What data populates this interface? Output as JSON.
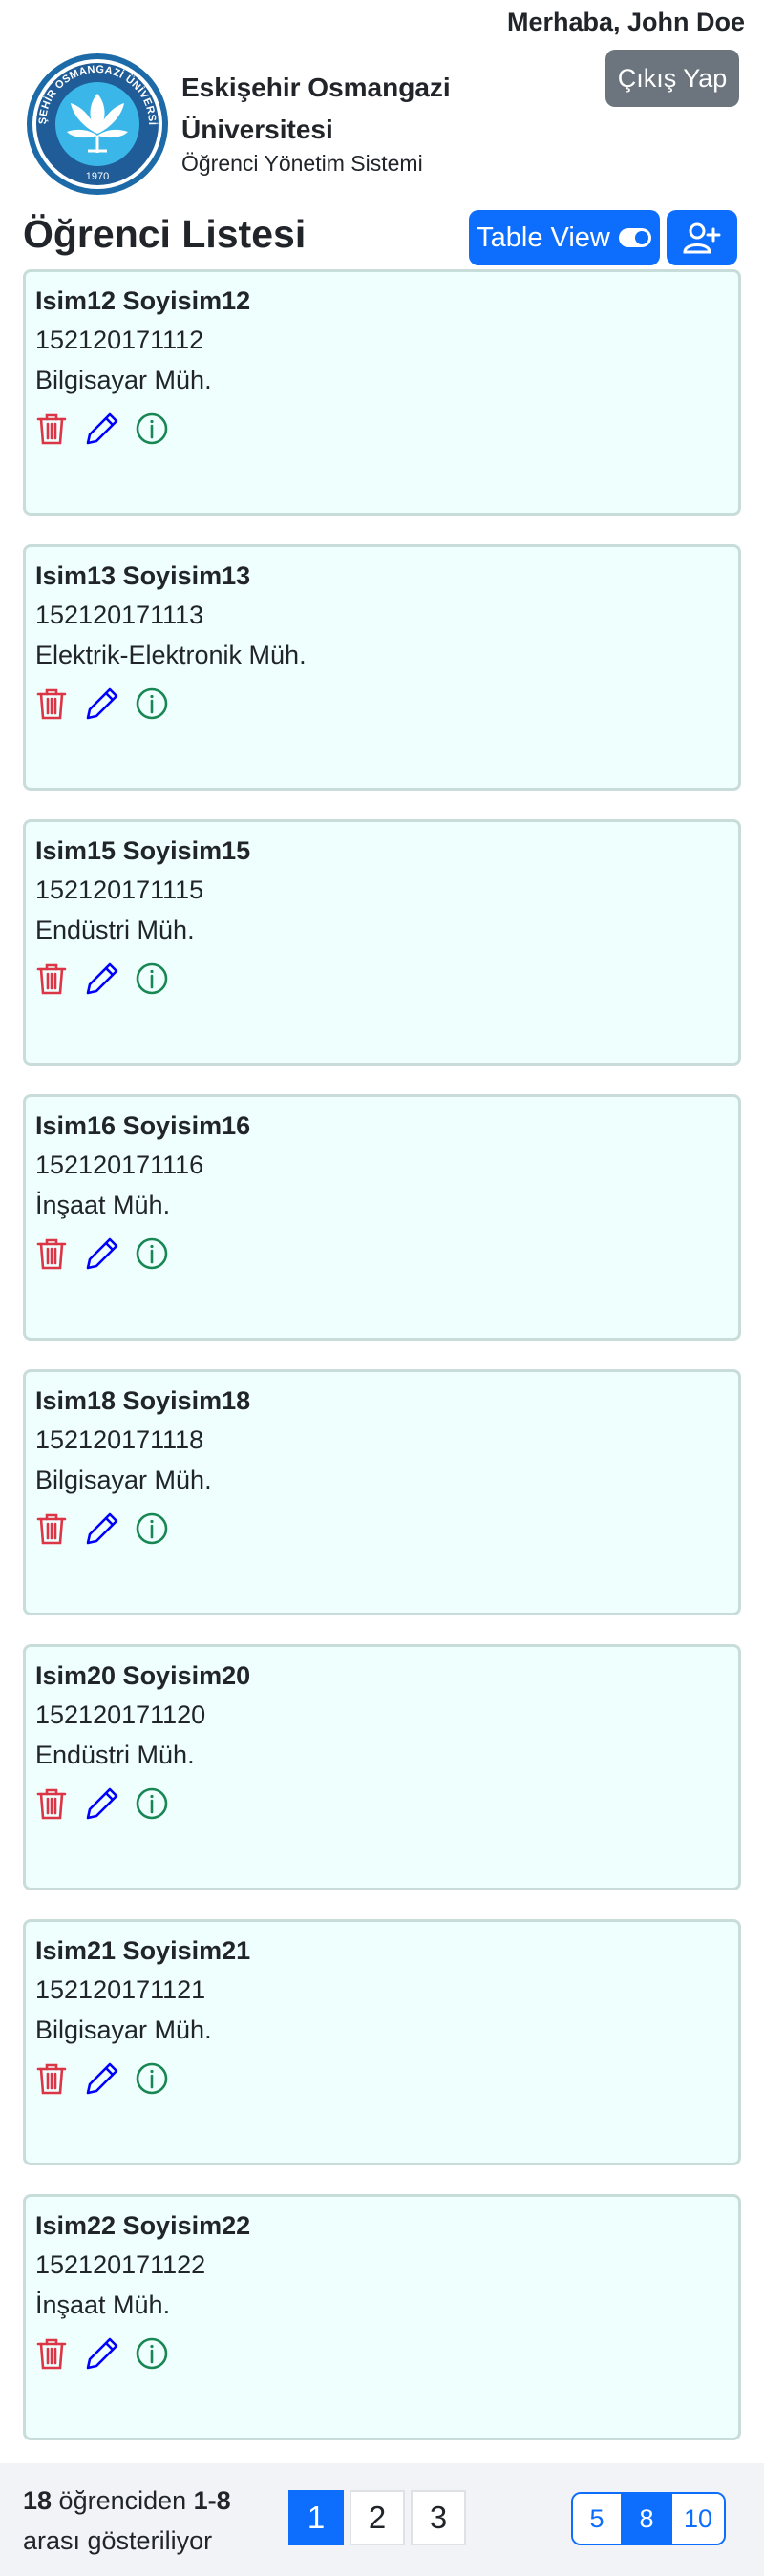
{
  "header": {
    "greeting": "Merhaba, John Doe",
    "logout_label": "Çıkış Yap",
    "university_name": "Eskişehir Osmangazi Üniversitesi",
    "system_name": "Öğrenci Yönetim Sistemi",
    "logo_text_top": "ESKİŞEHİR OSMANGAZİ ÜNİVERSİTESİ",
    "logo_year": "1970"
  },
  "page": {
    "title": "Öğrenci Listesi",
    "table_view_label": "Table View"
  },
  "students": [
    {
      "name": "Isim12 Soyisim12",
      "number": "152120171112",
      "department": "Bilgisayar Müh."
    },
    {
      "name": "Isim13 Soyisim13",
      "number": "152120171113",
      "department": "Elektrik-Elektronik Müh."
    },
    {
      "name": "Isim15 Soyisim15",
      "number": "152120171115",
      "department": "Endüstri Müh."
    },
    {
      "name": "Isim16 Soyisim16",
      "number": "152120171116",
      "department": "İnşaat Müh."
    },
    {
      "name": "Isim18 Soyisim18",
      "number": "152120171118",
      "department": "Bilgisayar Müh."
    },
    {
      "name": "Isim20 Soyisim20",
      "number": "152120171120",
      "department": "Endüstri Müh."
    },
    {
      "name": "Isim21 Soyisim21",
      "number": "152120171121",
      "department": "Bilgisayar Müh."
    },
    {
      "name": "Isim22 Soyisim22",
      "number": "152120171122",
      "department": "İnşaat Müh."
    }
  ],
  "icons": {
    "delete": "trash-icon",
    "edit": "pencil-icon",
    "info": "info-icon",
    "add": "person-plus-icon",
    "toggle": "toggle-icon"
  },
  "colors": {
    "primary": "#0d6efd",
    "danger": "#dc3545",
    "edit": "#0000ff",
    "info": "#198754",
    "secondary": "#6c757d",
    "card_bg": "#eefffe"
  },
  "footer": {
    "total": "18",
    "text_middle": " öğrenciden ",
    "range": "1-8",
    "text_end": "arası gösteriliyor",
    "pages": [
      "1",
      "2",
      "3"
    ],
    "active_page": "1",
    "page_sizes": [
      "5",
      "8",
      "10"
    ],
    "active_page_size": "8"
  }
}
